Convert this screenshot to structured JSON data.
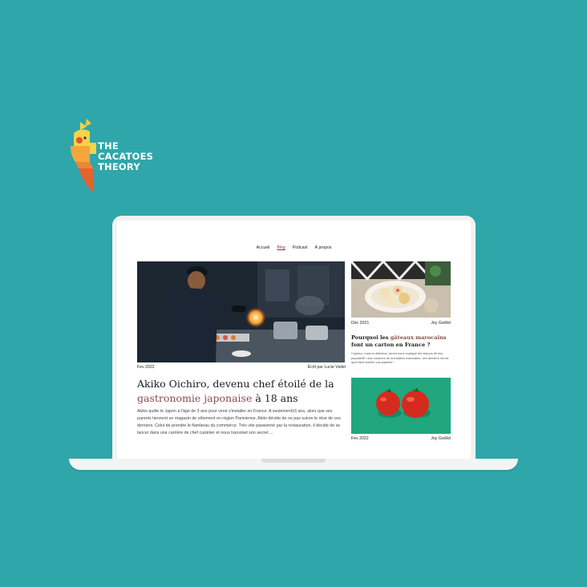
{
  "brand": {
    "line1": "THE",
    "line2": "CACATOES",
    "line3": "THEORY"
  },
  "nav": {
    "items": [
      "Accueil",
      "Blog",
      "Podcast",
      "À propos"
    ],
    "active": "Blog"
  },
  "main_article": {
    "date": "Fev 2022",
    "author": "Écrit par Lucie Vuilet",
    "title_part1": "Akiko Oichiro, devenu chef étoilé de la",
    "title_highlight": "gastronomie japonaise",
    "title_part2": "à 18 ans",
    "excerpt": "Akiko quitte le Japon à l'âge de 3 ans pour venir s'installer en France. A seulement16 ans, alors que ses parents tiennent un magasin de vêtement en région Parisienne, Akito décide de ne pas suivre le rêve de ces derniers. Celui de prendre le flambeau du commerce. Très vite passionné par la restauration, il décide de se lancer dans une carrière de chef cuisinier et nous transmet son secret ..."
  },
  "side_article_1": {
    "date": "Déc 2021",
    "author": "Joy Grellot",
    "title_part1": "Pourquoi les",
    "title_highlight": "gâteaux marocains",
    "title_part2": "font un carton en France ?",
    "excerpt": "Copieux, mais si délicieux, Amed nous explique les raisons de leur popularité ! Aux couleurs de la tradition marocaine, ces derniers ont de quoi faire éveiller vos papilles !"
  },
  "side_article_2": {
    "date": "Fev 2022",
    "author": "Joy Grellot"
  },
  "colors": {
    "background": "#2fa6aa",
    "accent": "#8b4b4b",
    "card_green": "#20a77e"
  }
}
